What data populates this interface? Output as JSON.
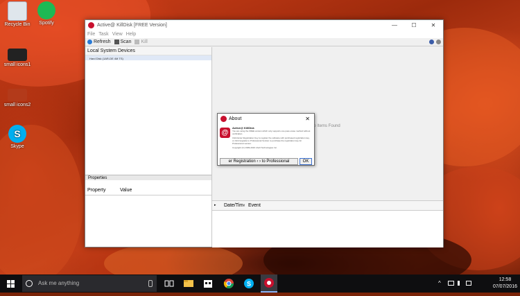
{
  "desktop": {
    "icons": [
      {
        "label": "Recycle Bin"
      },
      {
        "label": "Spotify"
      },
      {
        "label": "small icons1"
      },
      {
        "label": "small icons2"
      },
      {
        "label": "Skype"
      }
    ]
  },
  "window": {
    "title": "Active@ KillDisk [FREE Version]",
    "controls": {
      "minimize": "—",
      "maximize": "☐",
      "close": "✕"
    },
    "menu": [
      "File",
      "Task",
      "View",
      "Help"
    ],
    "toolbar": {
      "refresh": "Refresh",
      "scan": "Scan",
      "kill": "Kill"
    },
    "devices_header": "Local System Devices",
    "device_rows": [
      "Hard Disk (1AR-DE 4M TS)",
      ""
    ],
    "properties_header": "Properties",
    "property_columns": {
      "property": "Property",
      "value": "Value"
    },
    "no_items": "No Items Found",
    "log_columns": {
      "arrow": "▸",
      "datetime": "Date/Tim‹",
      "event": "Event"
    }
  },
  "about": {
    "title": "About",
    "close": "✕",
    "product": "Active@ KillDisk",
    "body_lines": [
      "You are using the FREE version which only supports one pass erase method without verification.",
      "Click Enter Registration Key to register the software with purchased registration key,",
      "or click Upgrade to Professional Version to purchase the registration key for Professional version.",
      "Copyright (C) 1999-2016 LSoft Technologies Inc."
    ],
    "logo": "@",
    "register_button": "er Registration ‹ › to Professional",
    "ok_button": "OK"
  },
  "taskbar": {
    "search_placeholder": "Ask me anything",
    "apps": [
      "task-view",
      "file-explorer",
      "store",
      "chrome",
      "skype",
      "killdisk"
    ],
    "tray_chevron": "^",
    "time": "12:58",
    "date": "07/07/2016"
  }
}
